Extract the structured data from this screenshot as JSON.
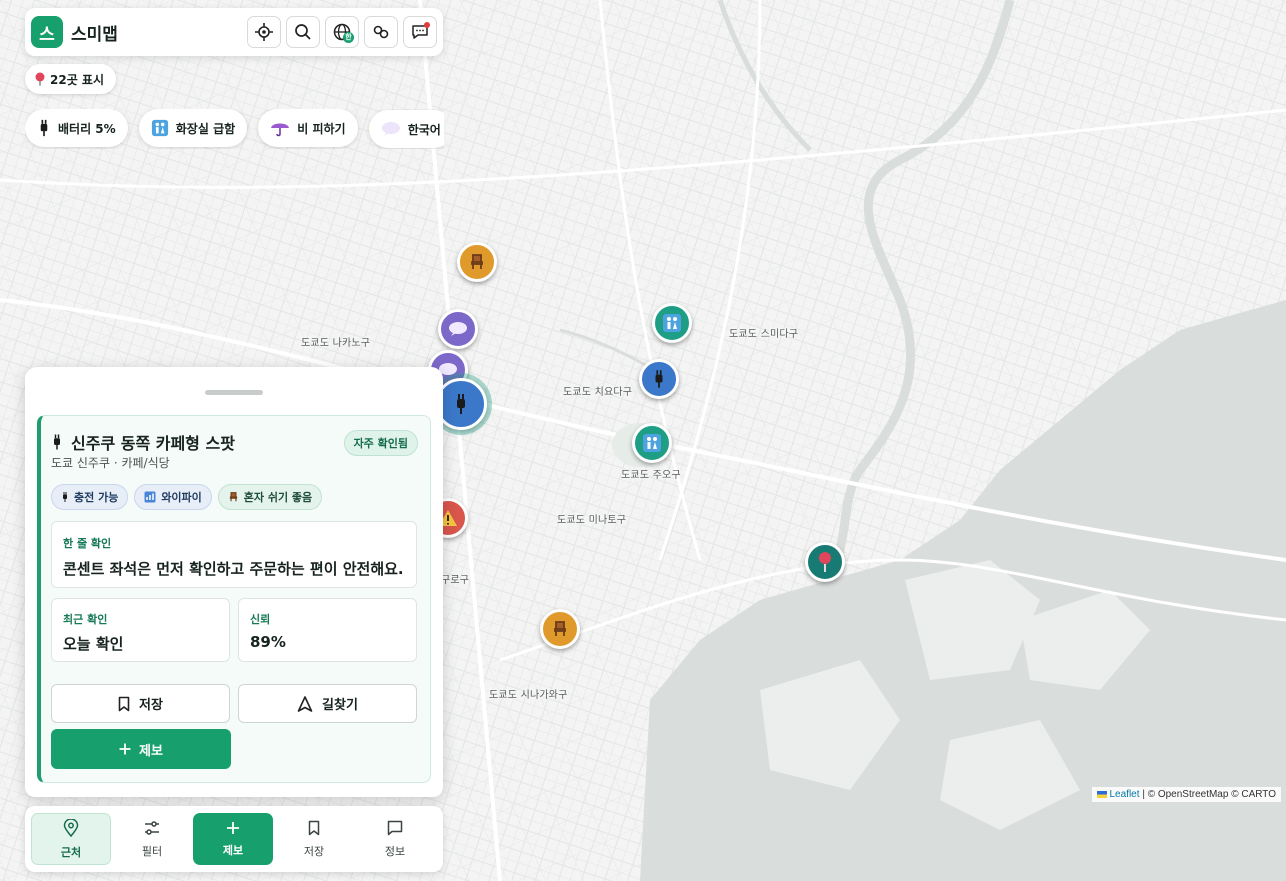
{
  "app": {
    "name": "스미맵",
    "logo_glyph": "스"
  },
  "topbar": {
    "buttons": [
      {
        "name": "locate",
        "icon": "crosshair-icon"
      },
      {
        "name": "search",
        "icon": "search-icon"
      },
      {
        "name": "language",
        "icon": "globe-icon"
      },
      {
        "name": "link",
        "icon": "link-icon"
      },
      {
        "name": "chat",
        "icon": "chat-icon"
      }
    ]
  },
  "place_count": "22곳 표시",
  "scenarios": [
    {
      "label": "배터리 5%",
      "icon": "plug-icon"
    },
    {
      "label": "화장실 급함",
      "icon": "restroom-icon"
    },
    {
      "label": "비 피하기",
      "icon": "umbrella-icon"
    },
    {
      "label": "한국어",
      "icon": "speech-bubble-icon"
    }
  ],
  "map": {
    "districts": [
      "도쿄도 나카노구",
      "도쿄도 스미다구",
      "도쿄도 치요다구",
      "도쿄도 주오구",
      "도쿄도 미나토구",
      "도쿄도 시나가와구",
      "구로구"
    ],
    "attribution": {
      "leaflet": "Leaflet",
      "rest": "| © OpenStreetMap © CARTO"
    }
  },
  "detail": {
    "title": "신주쿠 동쪽 카페형 스팟",
    "subtitle": "도쿄 신주쿠 · 카페/식당",
    "verified": "자주 확인됨",
    "tags": [
      "충전 가능",
      "와이파이",
      "혼자 쉬기 좋음"
    ],
    "tip_label": "한 줄 확인",
    "tip_text": "콘센트 좌석은 먼저 확인하고 주문하는 편이 안전해요.",
    "last_checked_label": "최근 확인",
    "last_checked_value": "오늘 확인",
    "trust_label": "신뢰",
    "trust_value": "89%",
    "save_label": "저장",
    "directions_label": "길찾기",
    "report_label": "제보"
  },
  "nav": [
    {
      "label": "근처",
      "icon": "map-pin-icon",
      "state": "active"
    },
    {
      "label": "필터",
      "icon": "sliders-icon",
      "state": "normal"
    },
    {
      "label": "제보",
      "icon": "plus-icon",
      "state": "primary"
    },
    {
      "label": "저장",
      "icon": "bookmark-icon",
      "state": "normal"
    },
    {
      "label": "정보",
      "icon": "message-square-icon",
      "state": "normal"
    }
  ],
  "colors": {
    "brand": "#17a06e",
    "water": "#d9dddb",
    "land": "#f2f3f2"
  }
}
